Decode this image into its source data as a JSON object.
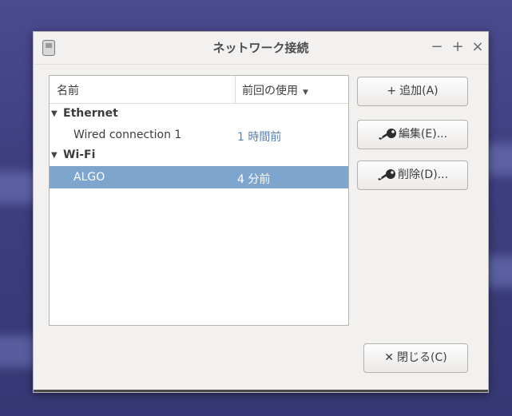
{
  "window": {
    "title": "ネットワーク接続",
    "minimize_label": "−",
    "maximize_label": "+",
    "close_label": "×"
  },
  "list": {
    "columns": [
      "名前",
      "前回の使用"
    ],
    "sort_indicator": "▼",
    "groups": [
      {
        "name": "Ethernet",
        "connections": [
          {
            "name": "Wired connection 1",
            "last_used": "1 時間前"
          }
        ]
      },
      {
        "name": "Wi-Fi",
        "connections": [
          {
            "name": "ALGO",
            "last_used": "4 分前",
            "selected": true
          }
        ]
      }
    ],
    "expander": "▼"
  },
  "buttons": {
    "add_label": "追加(A)",
    "add_icon": "+",
    "edit_label": "編集(E)...",
    "delete_label": "削除(D)...",
    "close_label": "閉じる(C)",
    "close_icon": "✕"
  },
  "colors": {
    "selection": "#7ea5cd",
    "window_bg": "#f2f1f0",
    "desktop": "#3e3f7f"
  }
}
